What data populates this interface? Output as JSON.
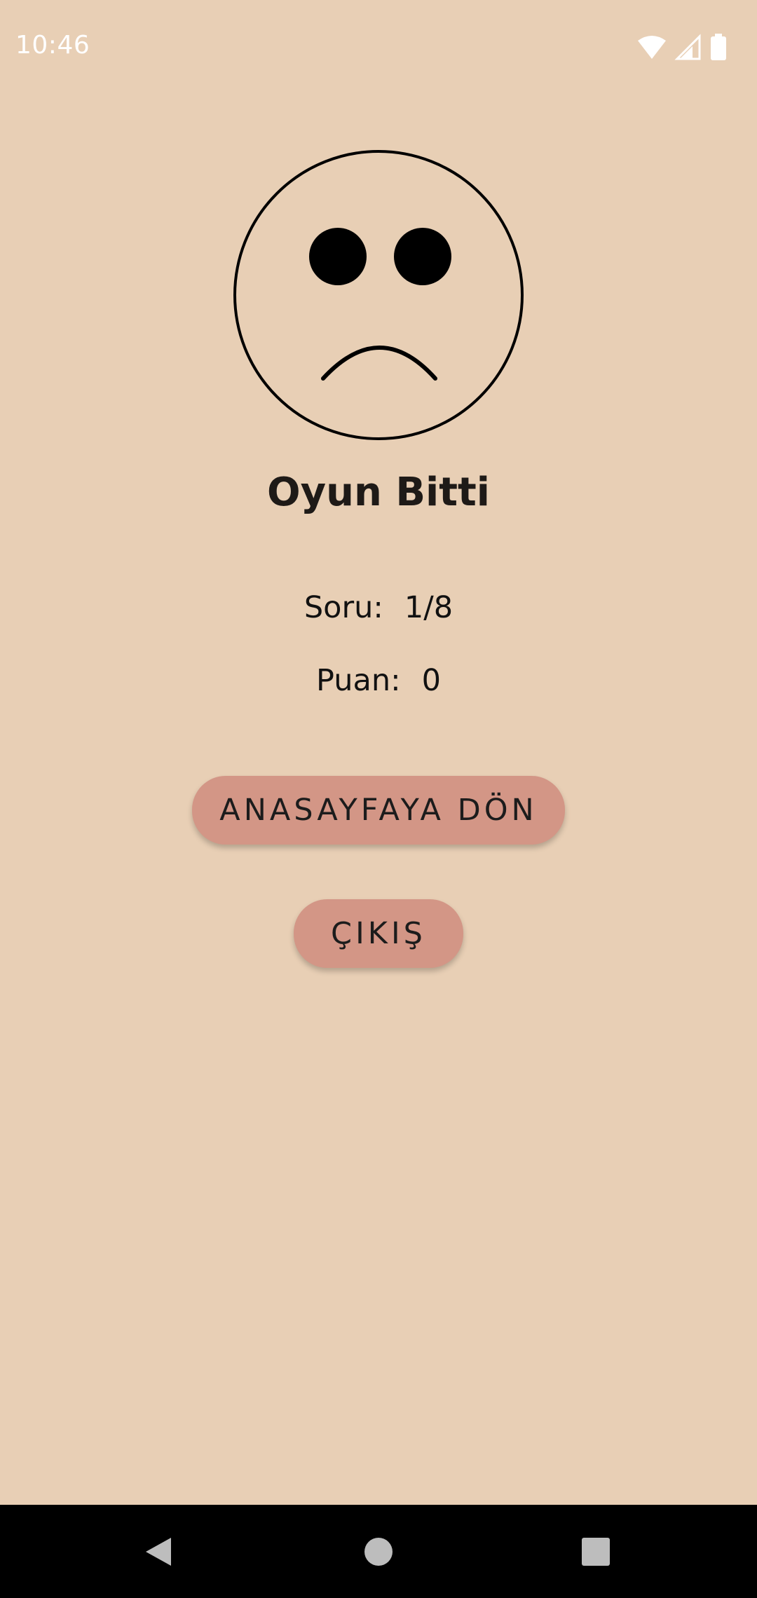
{
  "status_bar": {
    "time": "10:46",
    "icons": [
      "wifi-icon",
      "cell-signal-icon",
      "battery-icon"
    ]
  },
  "face": {
    "icon": "sad-face-icon",
    "mood": "sad"
  },
  "main": {
    "title": "Oyun Bitti",
    "question_label": "Soru:",
    "question_value": "1/8",
    "score_label": "Puan:",
    "score_value": "0"
  },
  "buttons": {
    "home_label": "ANASAYFAYA DÖN",
    "exit_label": "ÇIKIŞ"
  },
  "nav": {
    "back_icon": "back-icon",
    "home_icon": "home-icon",
    "recents_icon": "recents-icon"
  },
  "colors": {
    "background": "#E8CFB5",
    "button": "#D39686",
    "text": "#1e1a17",
    "nav_bar": "#000000"
  }
}
